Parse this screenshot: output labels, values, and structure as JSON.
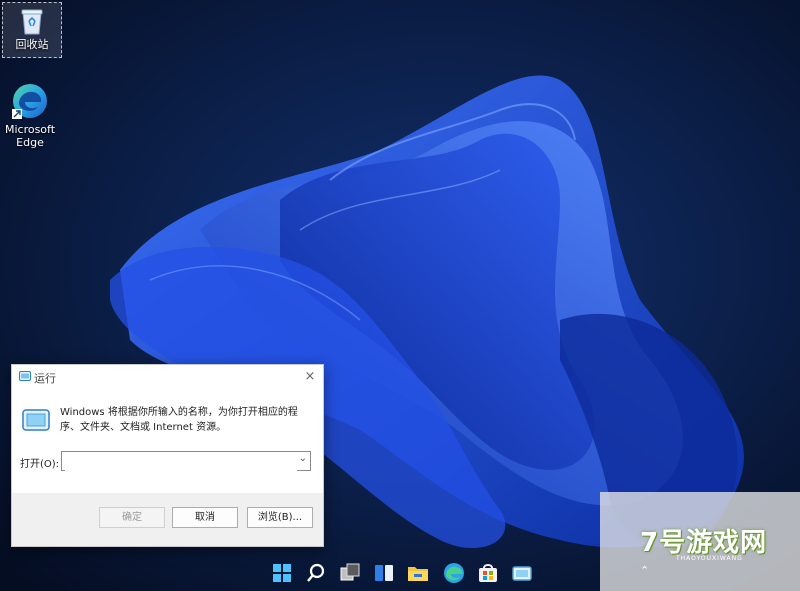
{
  "desktop": {
    "icons": [
      {
        "label": "回收站",
        "icon": "recycle-bin-icon"
      },
      {
        "label": "Microsoft\nEdge",
        "label_line1": "Microsoft",
        "label_line2": "Edge",
        "icon": "edge-icon"
      }
    ]
  },
  "run_dialog": {
    "title": "运行",
    "close_glyph": "×",
    "description": "Windows 将根据你所输入的名称，为你打开相应的程序、文件夹、文档或 Internet 资源。",
    "open_label": "打开(O):",
    "open_value": "",
    "ok_label": "确定",
    "cancel_label": "取消",
    "browse_label": "浏览(B)..."
  },
  "taskbar": {
    "icons": [
      "start-icon",
      "search-icon",
      "task-view-icon",
      "widgets-icon",
      "file-explorer-icon",
      "edge-icon",
      "store-icon",
      "run-icon"
    ]
  },
  "watermark": {
    "text": "7号游戏网",
    "sub": "THAOYOUXIWANG"
  },
  "colors": {
    "wallpaper_dark": "#07142e",
    "bloom_blue": "#1f4fe0",
    "dialog_bg": "#ffffff",
    "footer_bg": "#f0f0f0"
  }
}
